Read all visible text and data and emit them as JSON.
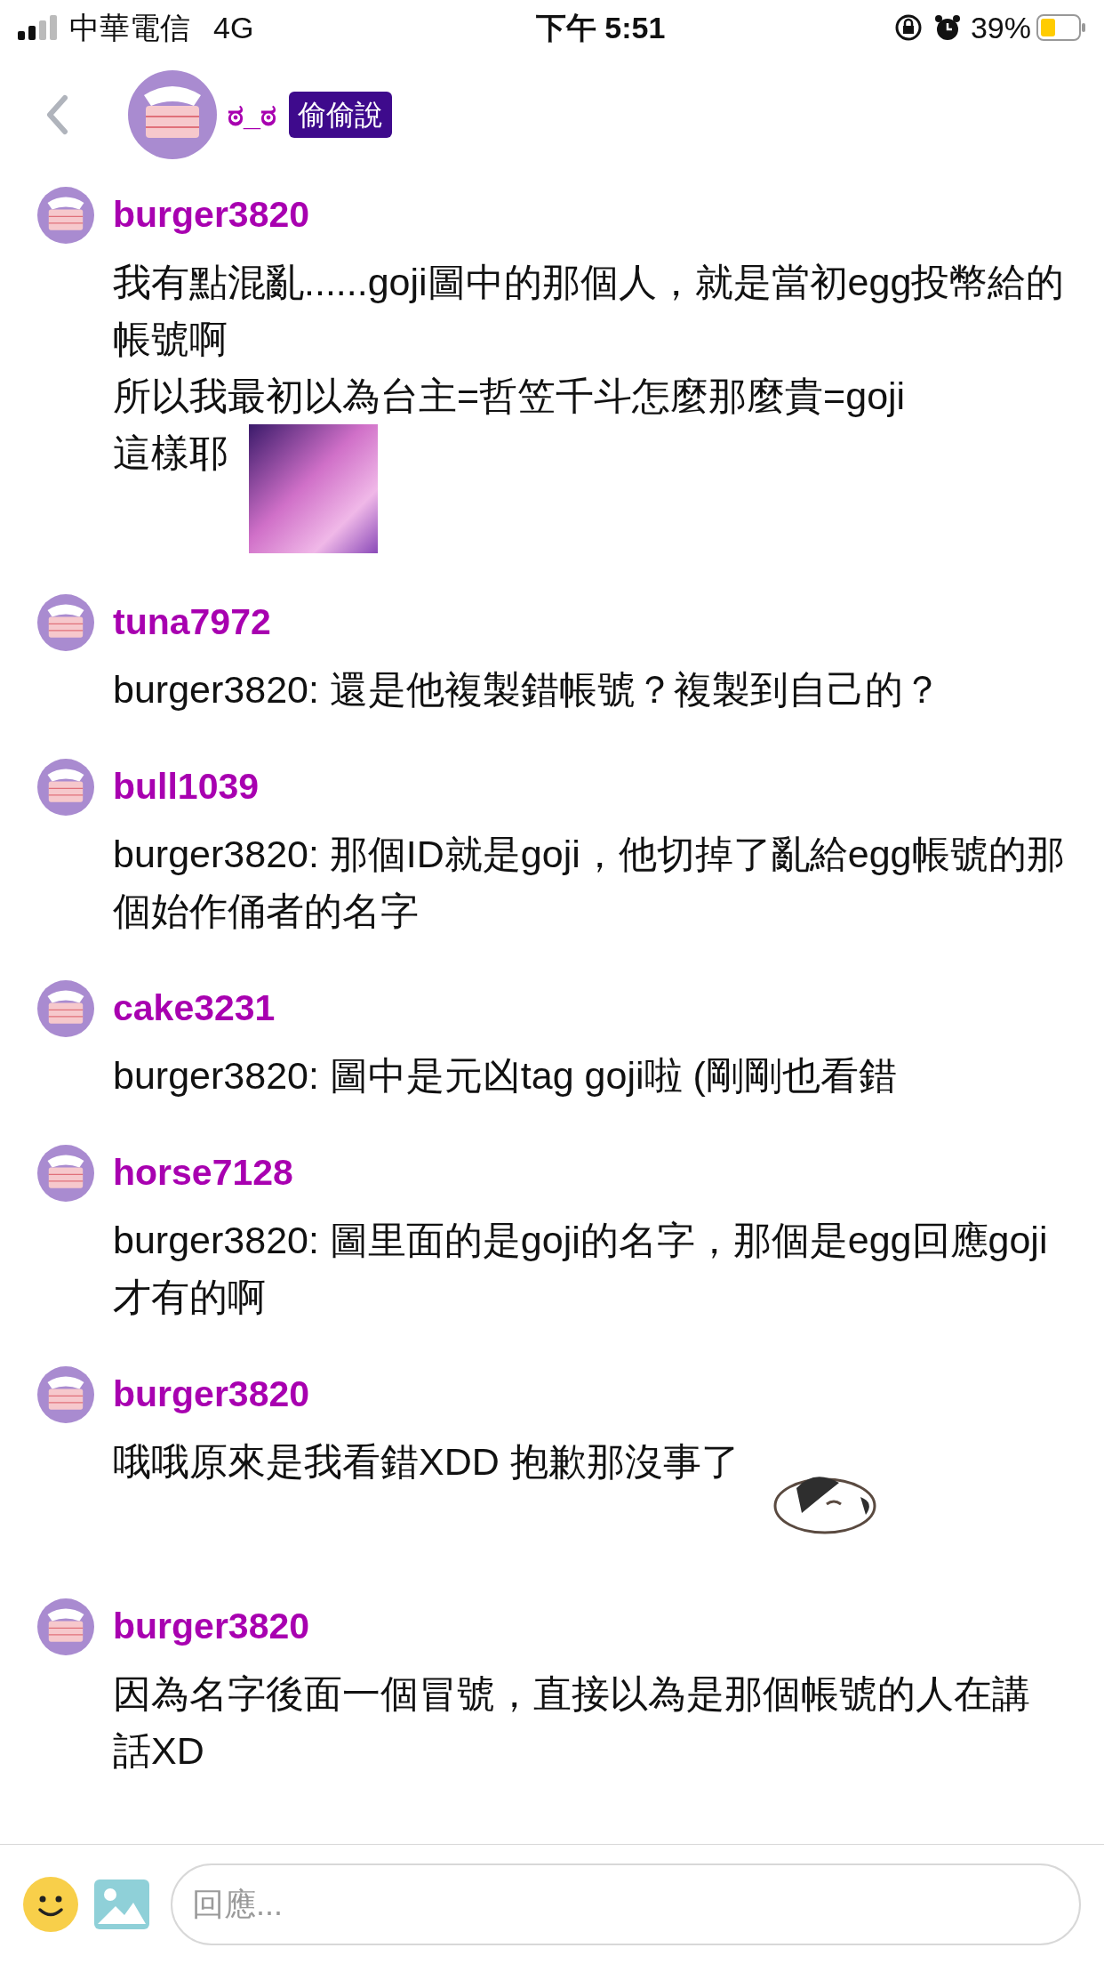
{
  "status_bar": {
    "carrier": "中華電信",
    "network": "4G",
    "time": "下午 5:51",
    "battery": "39%"
  },
  "header": {
    "title": "ಠ_ಠ",
    "badge": "偷偷說"
  },
  "messages": [
    {
      "user": "burger3820",
      "lines": [
        "我有點混亂......goji圖中的那個人，就是當初egg投幣給的帳號啊",
        "所以我最初以為台主=哲笠千斗怎麼那麼貴=goji",
        "這樣耶"
      ],
      "image": true
    },
    {
      "user": "tuna7972",
      "text": "burger3820: 還是他複製錯帳號？複製到自己的？"
    },
    {
      "user": "bull1039",
      "text": "burger3820: 那個ID就是goji，他切掉了亂給egg帳號的那個始作俑者的名字"
    },
    {
      "user": "cake3231",
      "text": "burger3820: 圖中是元凶tag goji啦 (剛剛也看錯"
    },
    {
      "user": "horse7128",
      "text": "burger3820: 圖里面的是goji的名字，那個是egg回應goji才有的啊"
    },
    {
      "user": "burger3820",
      "text": "哦哦原來是我看錯XDD 抱歉那沒事了",
      "sticker": true
    },
    {
      "user": "burger3820",
      "text": "因為名字後面一個冒號，直接以為是那個帳號的人在講話XD"
    }
  ],
  "reply": {
    "placeholder": "回應..."
  }
}
